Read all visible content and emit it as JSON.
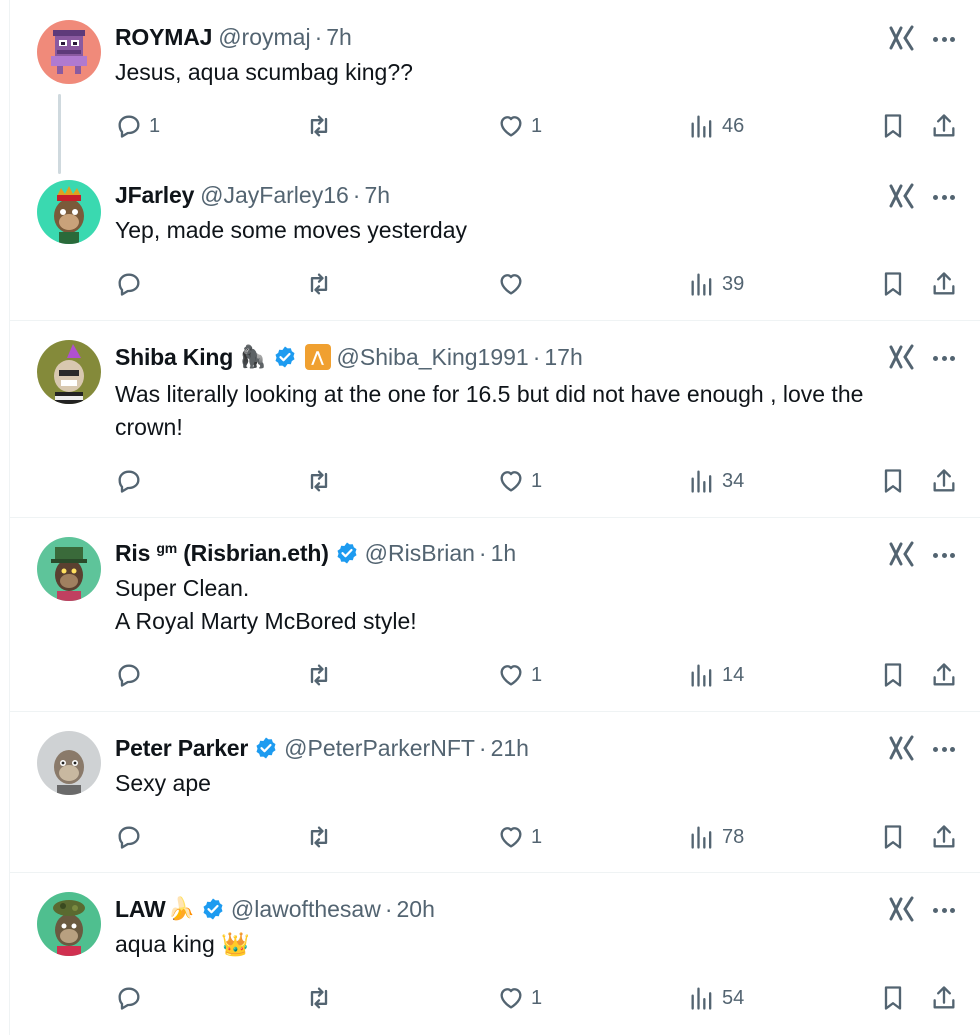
{
  "colors": {
    "text": "#0f1419",
    "secondary": "#536471",
    "verified": "#1d9bf0",
    "divider": "#eff3f4",
    "thread_line": "#cfd9de"
  },
  "tweets": [
    {
      "name": "ROYMAJ",
      "name_sup": "",
      "emoji": "",
      "verified": false,
      "handle": "@roymaj",
      "time": "7h",
      "lines": [
        "Jesus, aqua scumbag king??"
      ],
      "replies": "1",
      "retweets": "",
      "likes": "1",
      "views": "46",
      "avatar": "pink-pixel-avatar"
    },
    {
      "name": "JFarley",
      "name_sup": "",
      "emoji": "",
      "verified": false,
      "handle": "@JayFarley16",
      "time": "7h",
      "lines": [
        "Yep, made some moves yesterday"
      ],
      "replies": "",
      "retweets": "",
      "likes": "",
      "views": "39",
      "avatar": "ape-crown-avatar"
    },
    {
      "name": "Shiba King",
      "name_sup": "",
      "emoji": "🦍",
      "verified": true,
      "handle": "@Shiba_King1991",
      "time": "17h",
      "lines": [
        "Was literally looking at the one for 16.5 but did not have enough , love the",
        "crown!"
      ],
      "replies": "",
      "retweets": "",
      "likes": "1",
      "views": "34",
      "avatar": "ape-party-hat-avatar"
    },
    {
      "name": "Ris",
      "name_sup": "gm",
      "name_suffix": "(Risbrian.eth)",
      "emoji": "",
      "verified": true,
      "handle": "@RisBrian",
      "time": "1h",
      "lines": [
        "Super Clean.",
        "A Royal Marty McBored style!"
      ],
      "replies": "",
      "retweets": "",
      "likes": "1",
      "views": "14",
      "avatar": "ape-green-hat-avatar"
    },
    {
      "name": "Peter Parker",
      "name_sup": "",
      "emoji": "",
      "verified": true,
      "handle": "@PeterParkerNFT",
      "time": "21h",
      "lines": [
        "Sexy ape"
      ],
      "replies": "",
      "retweets": "",
      "likes": "1",
      "views": "78",
      "avatar": "ape-grey-avatar"
    },
    {
      "name": "LAW",
      "name_sup": "",
      "emoji": "🍌",
      "verified": true,
      "handle": "@lawofthesaw",
      "time": "20h",
      "lines": [
        "aqua king 👑"
      ],
      "replies": "",
      "retweets": "",
      "likes": "1",
      "views": "54",
      "avatar": "ape-camo-avatar"
    }
  ],
  "icons": {
    "reply": "reply-icon",
    "retweet": "retweet-icon",
    "like": "heart-icon",
    "views": "views-icon",
    "bookmark": "bookmark-icon",
    "share": "share-icon",
    "grok": "grok-icon",
    "more": "more-icon",
    "verified": "verified-badge-icon"
  }
}
